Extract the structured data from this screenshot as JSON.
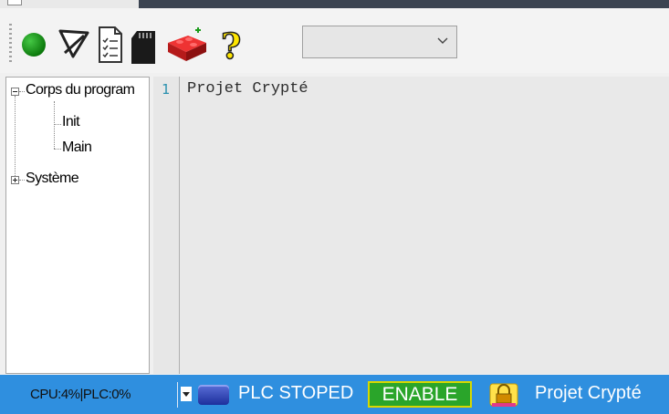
{
  "toolbar": {
    "combo_value": "",
    "icons": [
      "run-icon",
      "download-icon",
      "monitor-icon",
      "sd-card-icon",
      "brick-icon",
      "help-icon"
    ]
  },
  "tree": {
    "root_label": "Corps du program",
    "child1": "Init",
    "child2": "Main",
    "system_label": "Système"
  },
  "editor": {
    "line_number": "1",
    "line_text": "Projet Crypté"
  },
  "status": {
    "cpu": "CPU:4%|PLC:0%",
    "plc_state": "PLC STOPED",
    "enable": "ENABLE",
    "project": "Projet Crypté"
  },
  "colors": {
    "status_bg": "#2f8fdf",
    "enable_bg": "#2aa52a",
    "enable_border": "#d8d800",
    "line_number": "#2b91af"
  }
}
